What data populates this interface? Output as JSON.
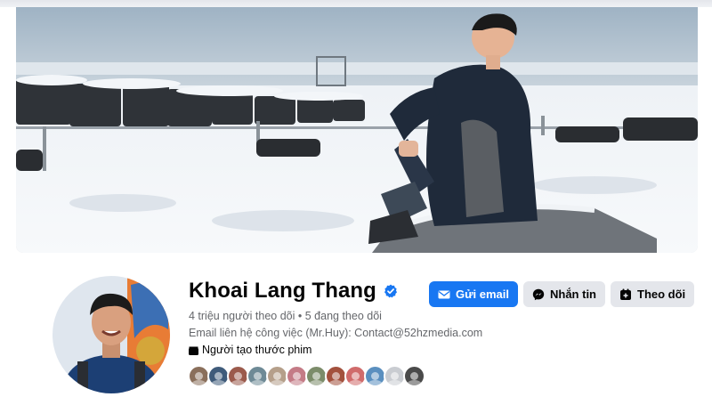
{
  "profile": {
    "name": "Khoai Lang Thang",
    "verified": true,
    "followers_line": "4 triệu người theo dõi • 5 đang theo dõi",
    "contact_line": "Email liên hệ công việc (Mr.Huy): Contact@52hzmedia.com",
    "category": "Người tạo thước phim"
  },
  "actions": {
    "send_email": "Gửi email",
    "message": "Nhắn tin",
    "follow": "Theo dõi"
  },
  "colors": {
    "primary": "#1877f2",
    "secondary_button": "#e4e6eb",
    "muted_text": "#65676b",
    "text": "#050505"
  },
  "icons": {
    "verified": "verified-badge-icon",
    "email": "envelope-icon",
    "messenger": "messenger-icon",
    "follow": "follow-icon",
    "category": "clapperboard-icon"
  },
  "friends_preview": {
    "count": 12,
    "colors": [
      "#8a6f5b",
      "#3f5b7a",
      "#9b5a4c",
      "#6e8a96",
      "#b59f8a",
      "#c47b86",
      "#7c8c6a",
      "#a3513d",
      "#d06b6b",
      "#5a8fbf",
      "#c9ccd1",
      "#4a4a4a"
    ]
  }
}
